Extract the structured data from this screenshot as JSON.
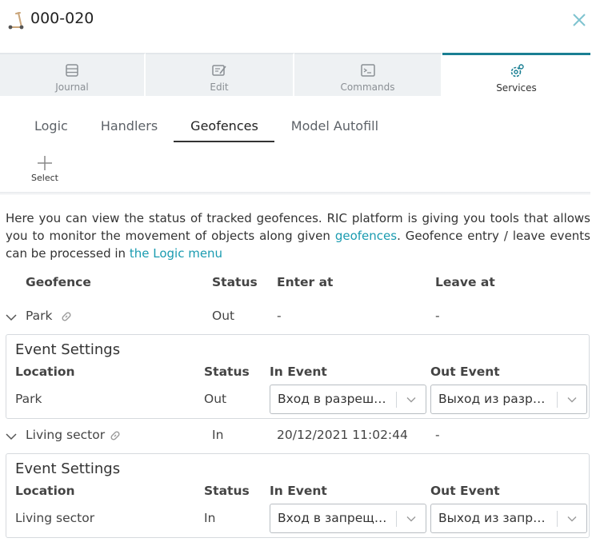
{
  "header": {
    "title": "000-020",
    "icon": "scooter-icon",
    "close_icon": "close-icon",
    "accent": "#1a7f93"
  },
  "tabs": [
    {
      "label": "Journal",
      "icon": "journal-icon",
      "active": false
    },
    {
      "label": "Edit",
      "icon": "edit-icon",
      "active": false
    },
    {
      "label": "Commands",
      "icon": "terminal-icon",
      "active": false
    },
    {
      "label": "Services",
      "icon": "gear-services-icon",
      "active": true
    }
  ],
  "subtabs": [
    {
      "label": "Logic",
      "active": false
    },
    {
      "label": "Handlers",
      "active": false
    },
    {
      "label": "Geofences",
      "active": true
    },
    {
      "label": "Model Autofill",
      "active": false
    }
  ],
  "toolbar": {
    "select_label": "Select"
  },
  "intro": {
    "part1": "Here you can view the status of tracked geofences. RIC platform is giving you tools that allows you to monitor the movement of objects along given ",
    "link1": "geofences",
    "part2": ". Geofence entry / leave events can be processed in ",
    "link2": "the Logic menu",
    "link_color": "#1a9bb0"
  },
  "table": {
    "headers": {
      "geofence": "Geofence",
      "status": "Status",
      "enter_at": "Enter at",
      "leave_at": "Leave at"
    },
    "rows": [
      {
        "geofence": "Park",
        "status": "Out",
        "enter_at": "-",
        "leave_at": "-",
        "settings": {
          "title": "Event Settings",
          "headers": {
            "location": "Location",
            "status": "Status",
            "in_event": "In Event",
            "out_event": "Out Event"
          },
          "location": "Park",
          "status": "Out",
          "in_event": "Вход в разреше...",
          "out_event": "Выход из разре..."
        }
      },
      {
        "geofence": "Living sector",
        "status": "In",
        "enter_at": "20/12/2021 11:02:44",
        "leave_at": "-",
        "settings": {
          "title": "Event Settings",
          "headers": {
            "location": "Location",
            "status": "Status",
            "in_event": "In Event",
            "out_event": "Out Event"
          },
          "location": "Living sector",
          "status": "In",
          "in_event": "Вход в запреще...",
          "out_event": "Выход из запре..."
        }
      }
    ]
  }
}
